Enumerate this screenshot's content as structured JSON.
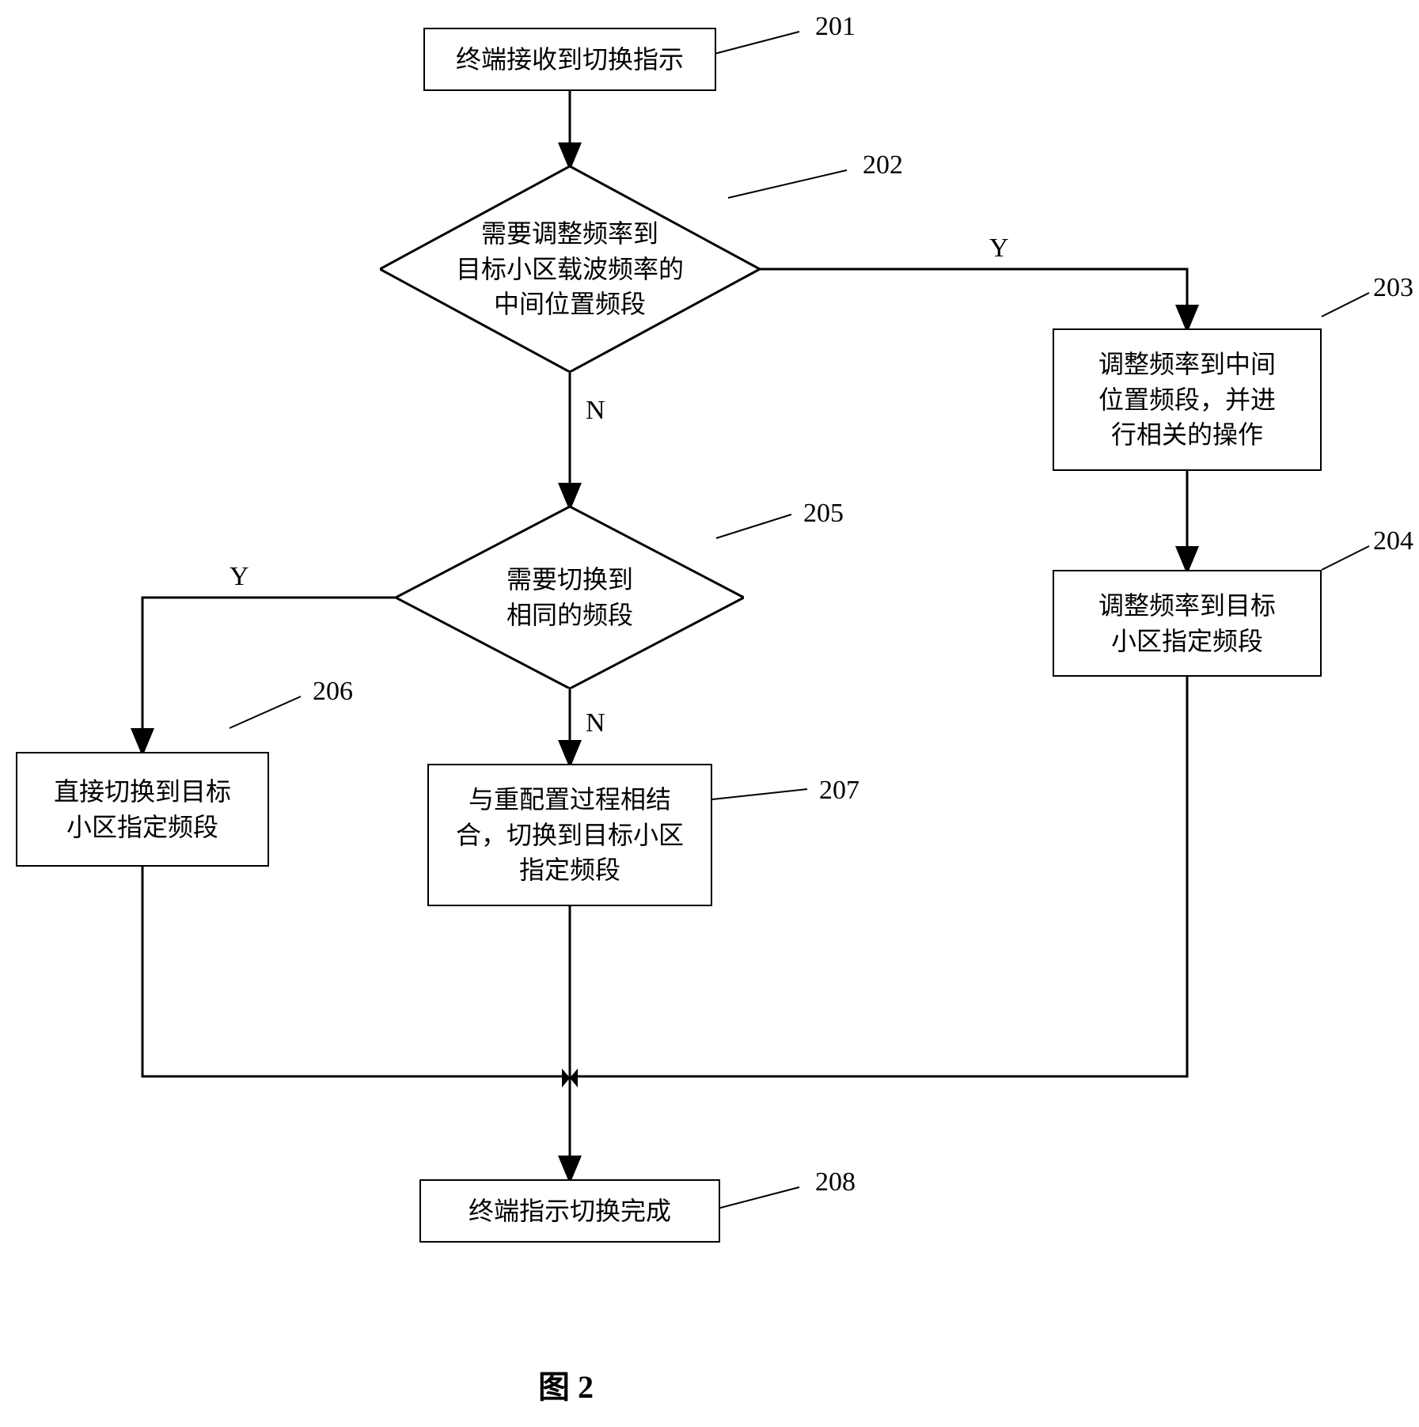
{
  "nodes": {
    "n201": {
      "text": "终端接收到切换指示",
      "num": "201"
    },
    "n202": {
      "text": "需要调整频率到\n目标小区载波频率的\n中间位置频段",
      "num": "202"
    },
    "n203": {
      "text": "调整频率到中间\n位置频段，并进\n行相关的操作",
      "num": "203"
    },
    "n204": {
      "text": "调整频率到目标\n小区指定频段",
      "num": "204"
    },
    "n205": {
      "text": "需要切换到\n相同的频段",
      "num": "205"
    },
    "n206": {
      "text": "直接切换到目标\n小区指定频段",
      "num": "206"
    },
    "n207": {
      "text": "与重配置过程相结\n合，切换到目标小区\n指定频段",
      "num": "207"
    },
    "n208": {
      "text": "终端指示切换完成",
      "num": "208"
    }
  },
  "edge_labels": {
    "yes": "Y",
    "no": "N"
  },
  "caption": "图 2",
  "chart_data": {
    "type": "flowchart",
    "title": "图 2",
    "description": "Terminal handover frequency adjustment flowchart",
    "nodes": [
      {
        "id": "201",
        "shape": "process",
        "text": "终端接收到切换指示"
      },
      {
        "id": "202",
        "shape": "decision",
        "text": "需要调整频率到目标小区载波频率的中间位置频段"
      },
      {
        "id": "203",
        "shape": "process",
        "text": "调整频率到中间位置频段，并进行相关的操作"
      },
      {
        "id": "204",
        "shape": "process",
        "text": "调整频率到目标小区指定频段"
      },
      {
        "id": "205",
        "shape": "decision",
        "text": "需要切换到相同的频段"
      },
      {
        "id": "206",
        "shape": "process",
        "text": "直接切换到目标小区指定频段"
      },
      {
        "id": "207",
        "shape": "process",
        "text": "与重配置过程相结合，切换到目标小区指定频段"
      },
      {
        "id": "208",
        "shape": "process",
        "text": "终端指示切换完成"
      }
    ],
    "edges": [
      {
        "from": "201",
        "to": "202",
        "label": ""
      },
      {
        "from": "202",
        "to": "203",
        "label": "Y"
      },
      {
        "from": "202",
        "to": "205",
        "label": "N"
      },
      {
        "from": "203",
        "to": "204",
        "label": ""
      },
      {
        "from": "205",
        "to": "206",
        "label": "Y"
      },
      {
        "from": "205",
        "to": "207",
        "label": "N"
      },
      {
        "from": "204",
        "to": "208",
        "label": ""
      },
      {
        "from": "206",
        "to": "208",
        "label": ""
      },
      {
        "from": "207",
        "to": "208",
        "label": ""
      }
    ]
  }
}
